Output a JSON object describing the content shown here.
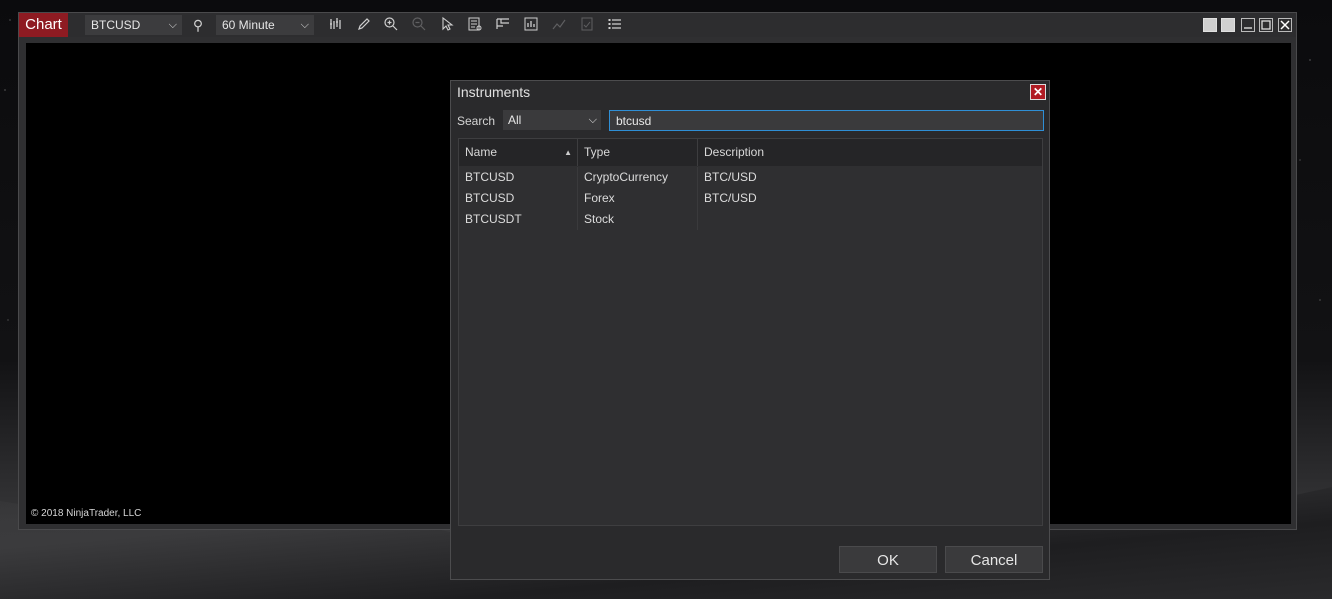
{
  "chart_window": {
    "label": "Chart",
    "instrument_value": "BTCUSD",
    "interval_value": "60 Minute",
    "copyright": "© 2018 NinjaTrader, LLC"
  },
  "toolbar_icons": [
    {
      "name": "instrument-search-icon",
      "glyph": "⚲"
    },
    {
      "name": "bar-type-icon",
      "glyph": "⫼"
    },
    {
      "name": "drawing-tool-icon",
      "glyph": "✎"
    },
    {
      "name": "zoom-in-icon",
      "glyph": "⊕"
    },
    {
      "name": "zoom-out-icon",
      "glyph": "⊖"
    },
    {
      "name": "pointer-icon",
      "glyph": "↖"
    },
    {
      "name": "data-box-icon",
      "glyph": "▤"
    },
    {
      "name": "chart-trader-icon",
      "glyph": "⊟"
    },
    {
      "name": "indicators-icon",
      "glyph": "▦"
    },
    {
      "name": "strategies-icon",
      "glyph": "⟋"
    },
    {
      "name": "templates-icon",
      "glyph": "▧"
    },
    {
      "name": "properties-icon",
      "glyph": "☰"
    }
  ],
  "dialog": {
    "title": "Instruments",
    "search_label": "Search",
    "search_scope": "All",
    "search_value": "btcusd",
    "columns": [
      "Name",
      "Type",
      "Description"
    ],
    "rows": [
      {
        "name": "BTCUSD",
        "type": "CryptoCurrency",
        "description": "BTC/USD"
      },
      {
        "name": "BTCUSD",
        "type": "Forex",
        "description": "BTC/USD"
      },
      {
        "name": "BTCUSDT",
        "type": "Stock",
        "description": ""
      }
    ],
    "ok_label": "OK",
    "cancel_label": "Cancel"
  }
}
